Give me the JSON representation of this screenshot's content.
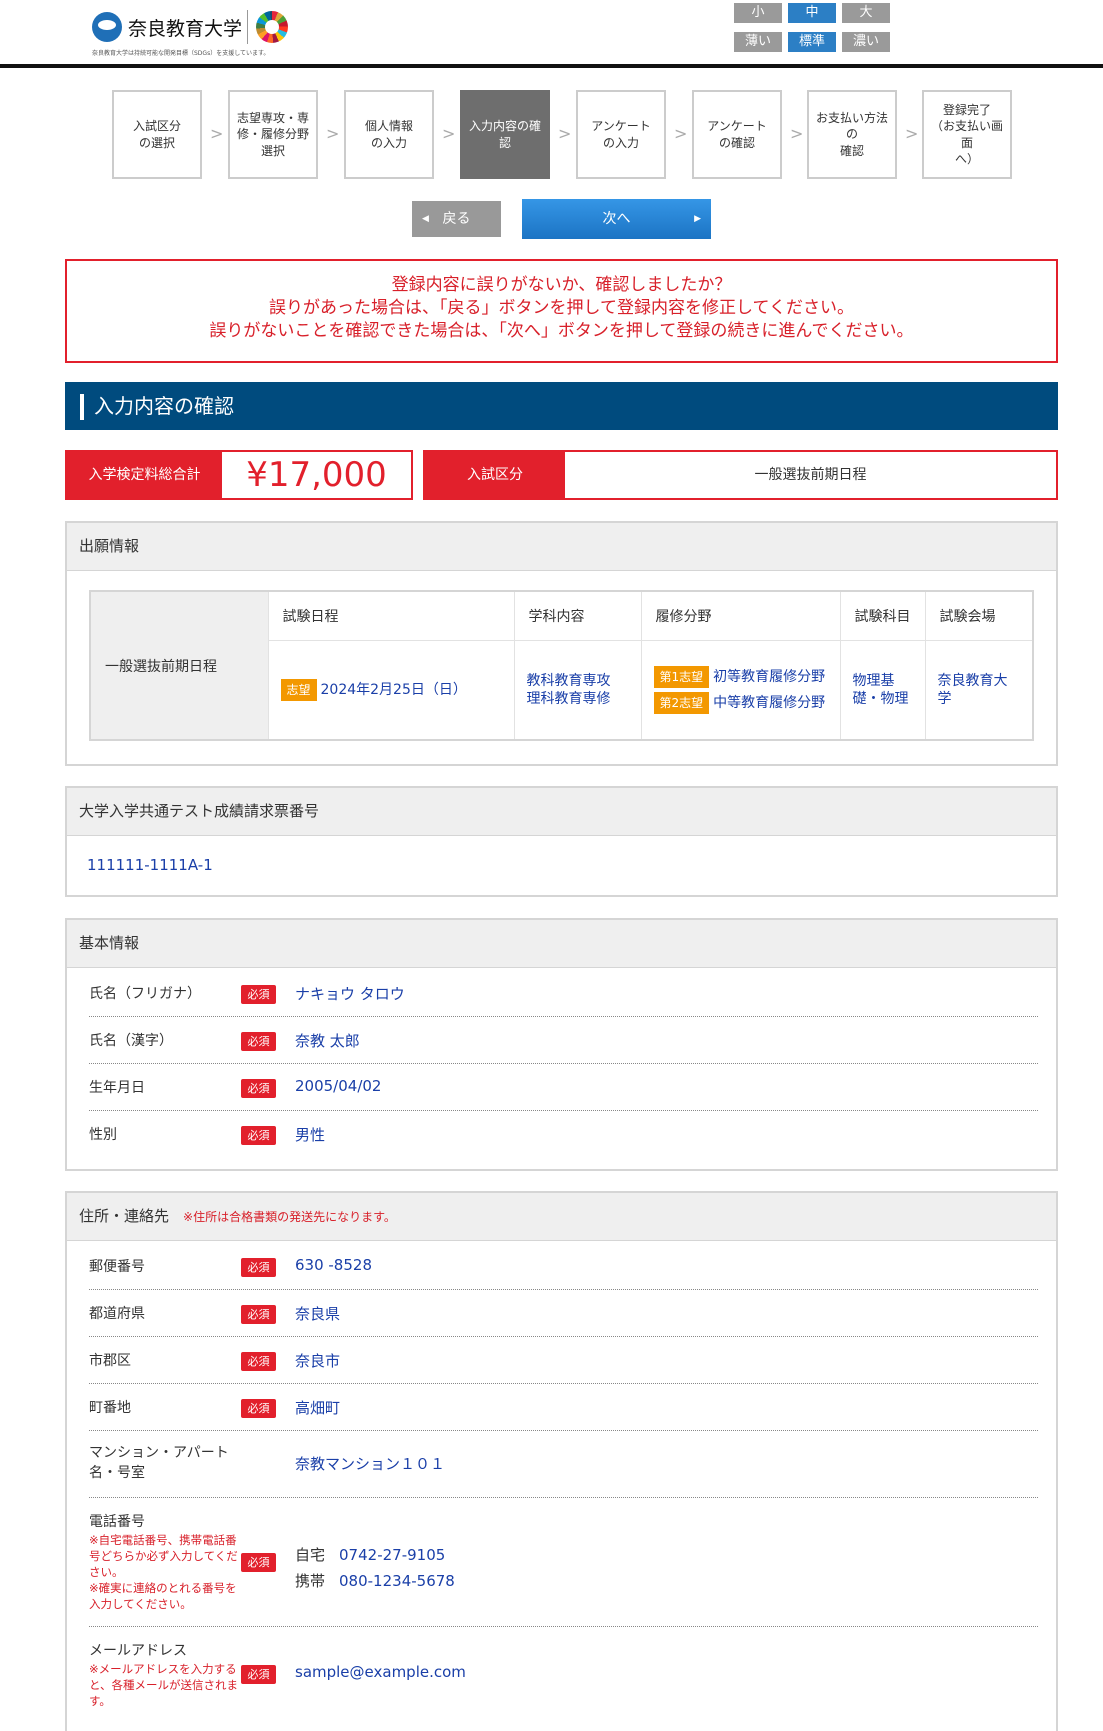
{
  "header": {
    "university_name": "奈良教育大学",
    "tagline": "奈良教育大学は持続可能な開発目標（SDGs）を支援しています。",
    "font_size_buttons": [
      "小",
      "中",
      "大"
    ],
    "contrast_buttons": [
      "薄い",
      "標準",
      "濃い"
    ],
    "active_font_size": "中",
    "active_contrast": "標準"
  },
  "steps": [
    "入試区分\nの選択",
    "志望専攻・専\n修・履修分野\n選択",
    "個人情報\nの入力",
    "入力内容の確認",
    "アンケート\nの入力",
    "アンケート\nの確認",
    "お支払い方法の\n確認",
    "登録完了\n（お支払い画面\nへ）"
  ],
  "current_step": 4,
  "nav": {
    "back_label": "戻る",
    "next_label": "次へ"
  },
  "notice": [
    "登録内容に誤りがないか、確認しましたか？",
    "誤りがあった場合は、「戻る」ボタンを押して登録内容を修正してください。",
    "誤りがないことを確認できた場合は、「次へ」ボタンを押して登録の続きに進んでください。"
  ],
  "section_title": "入力内容の確認",
  "summary": {
    "fee_label": "入学検定料総合計",
    "fee_value": "¥17,000",
    "category_label": "入試区分",
    "category_value": "一般選抜前期日程"
  },
  "application": {
    "title": "出願情報",
    "columns": [
      "試験日程",
      "学科内容",
      "履修分野",
      "試験科目",
      "試験会場"
    ],
    "exam_name": "一般選抜前期日程",
    "date_tag": "志望",
    "date": "2024年2月25日（日）",
    "department": "教科教育専攻\n理科教育専修",
    "field_tag1": "第1志望",
    "field_text1": "初等教育履修分野",
    "field_tag2": "第2志望",
    "field_text2": "中等教育履修分野",
    "subject": "物理基礎・物理",
    "venue": "奈良教育大学"
  },
  "common_test": {
    "title": "大学入学共通テスト成績請求票番号",
    "number": "111111-1111A-1"
  },
  "basic_info": {
    "title": "基本情報",
    "required_label": "必須",
    "rows": [
      {
        "label": "氏名（フリガナ）",
        "value": "ナキョウ タロウ"
      },
      {
        "label": "氏名（漢字）",
        "value": "奈教 太郎"
      },
      {
        "label": "生年月日",
        "value": "2005/04/02"
      },
      {
        "label": "性別",
        "value": "男性"
      }
    ]
  },
  "address": {
    "title": "住所・連絡先",
    "note": "※住所は合格書類の発送先になります。",
    "required_label": "必須",
    "rows": [
      {
        "label": "郵便番号",
        "value": "630 -8528"
      },
      {
        "label": "都道府県",
        "value": "奈良県"
      },
      {
        "label": "市郡区",
        "value": "奈良市"
      },
      {
        "label": "町番地",
        "value": "高畑町"
      },
      {
        "label": "マンション・アパート\n名・号室",
        "value": "奈教マンション１０１"
      }
    ],
    "phone": {
      "label": "電話番号",
      "note": "※自宅電話番号、携帯電話番号どちらか必ず入力してください。\n※確実に連絡のとれる番号を入力してください。",
      "home_label": "自宅",
      "home": "0742-27-9105",
      "mobile_label": "携帯",
      "mobile": "080-1234-5678"
    },
    "email": {
      "label": "メールアドレス",
      "note": "※メールアドレスを入力すると、各種メールが送信されます。",
      "value": "sample@example.com"
    }
  },
  "colors": {
    "primary_blue": "#004b7e",
    "accent_red": "#e2202c",
    "tag_orange": "#f39800",
    "link_blue": "#1a3fa8"
  }
}
